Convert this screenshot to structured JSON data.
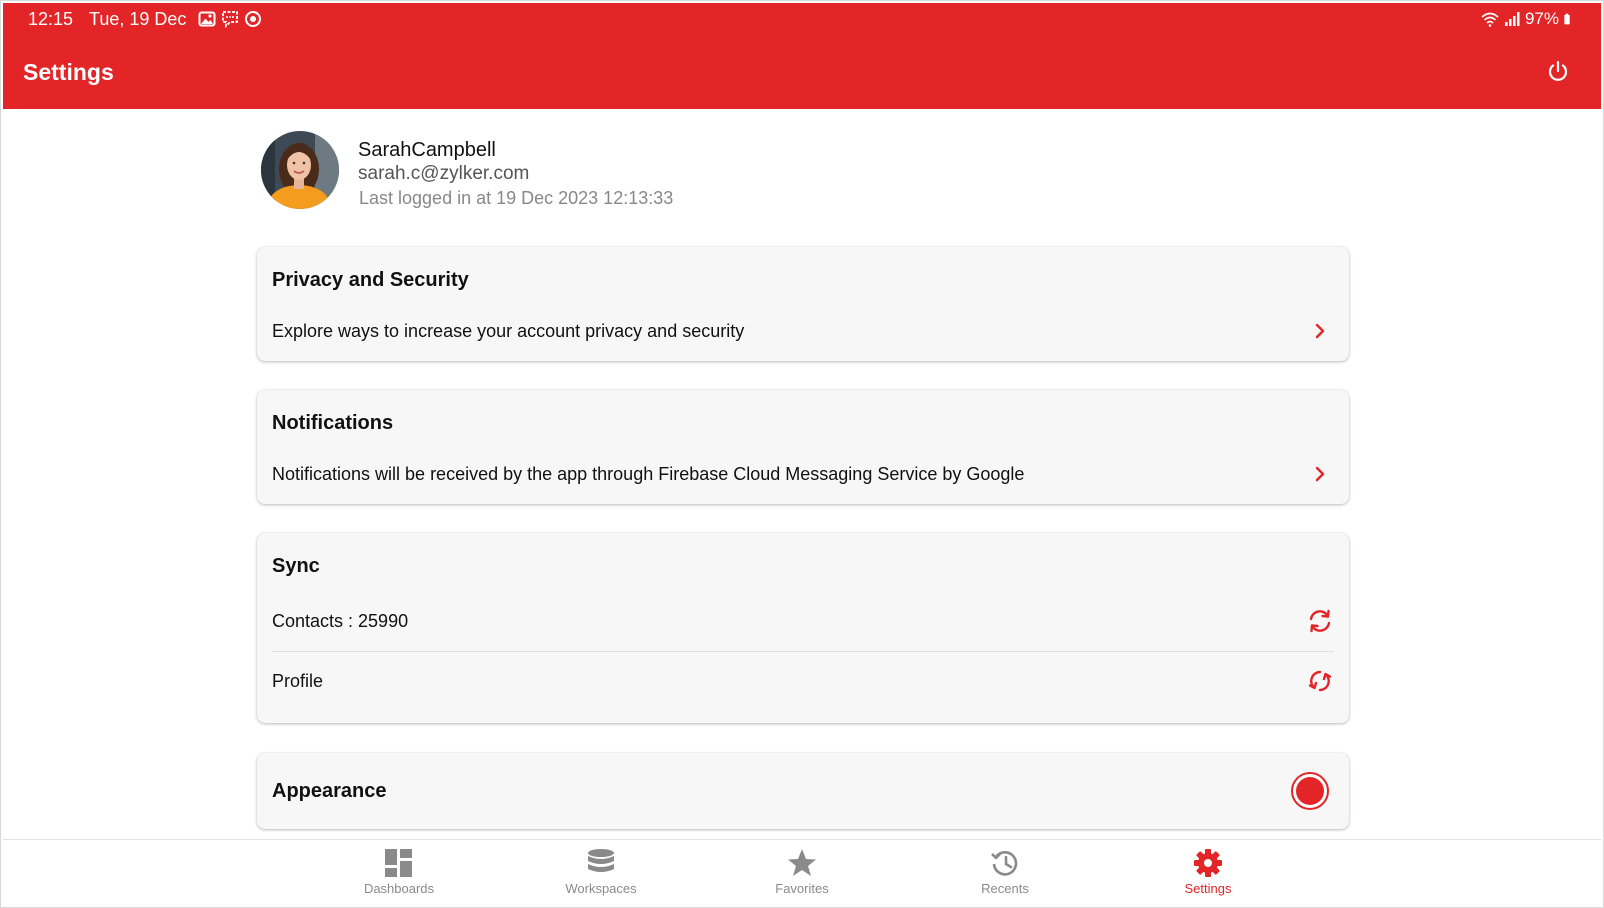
{
  "status_bar": {
    "time": "12:15",
    "date": "Tue, 19 Dec",
    "battery": "97%",
    "left_icons": [
      "gallery-icon",
      "message-icon",
      "sync-app-icon"
    ],
    "right_icons": [
      "wifi-icon",
      "signal-icon",
      "battery-icon"
    ]
  },
  "header": {
    "title": "Settings",
    "power_icon": "power-icon"
  },
  "profile": {
    "name": "SarahCampbell",
    "email": "sarah.c@zylker.com",
    "last_login": "Last logged in at 19 Dec 2023 12:13:33"
  },
  "sections": {
    "privacy": {
      "title": "Privacy and Security",
      "description": "Explore ways to increase your account privacy and security"
    },
    "notifications": {
      "title": "Notifications",
      "description": "Notifications will be received by the app through Firebase Cloud Messaging Service by Google"
    },
    "sync": {
      "title": "Sync",
      "contacts": "Contacts : 25990",
      "profile": "Profile"
    },
    "appearance": {
      "title": "Appearance",
      "selected_color": "#e32528"
    }
  },
  "bottom_nav": {
    "items": [
      {
        "label": "Dashboards",
        "icon": "dashboard-icon"
      },
      {
        "label": "Workspaces",
        "icon": "database-icon"
      },
      {
        "label": "Favorites",
        "icon": "star-icon"
      },
      {
        "label": "Recents",
        "icon": "history-icon"
      },
      {
        "label": "Settings",
        "icon": "gear-icon"
      }
    ],
    "active_index": 4
  },
  "colors": {
    "brand": "#e32528",
    "nav_inactive": "#8a8a8a"
  }
}
